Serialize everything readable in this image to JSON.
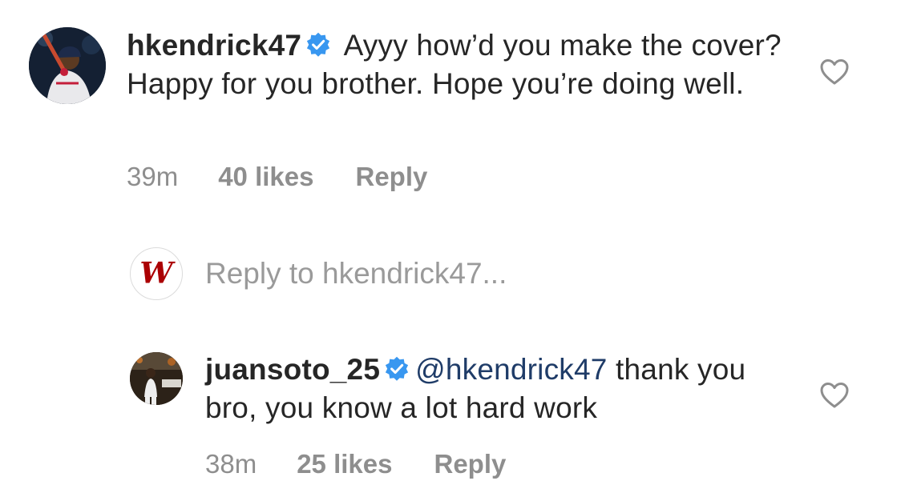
{
  "comments": [
    {
      "username": "hkendrick47",
      "verified": true,
      "text": " Ayyy how’d you make the cover? Happy for you brother. Hope you’re doing well.",
      "time": "39m",
      "likes": "40 likes",
      "reply_label": "Reply"
    },
    {
      "username": "juansoto_25",
      "verified": true,
      "mention": "@hkendrick47",
      "text": " thank you bro, you know a lot hard work",
      "time": "38m",
      "likes": "25 likes",
      "reply_label": "Reply"
    }
  ],
  "composer": {
    "placeholder": "Reply to hkendrick47..."
  },
  "colors": {
    "text": "#262626",
    "meta": "#8e8e8e",
    "mention": "#1f3c68",
    "verified": "#3897f0",
    "nationals_red": "#ab0003"
  },
  "icons": {
    "like": "heart-outline-icon",
    "verified": "verified-badge-icon"
  }
}
